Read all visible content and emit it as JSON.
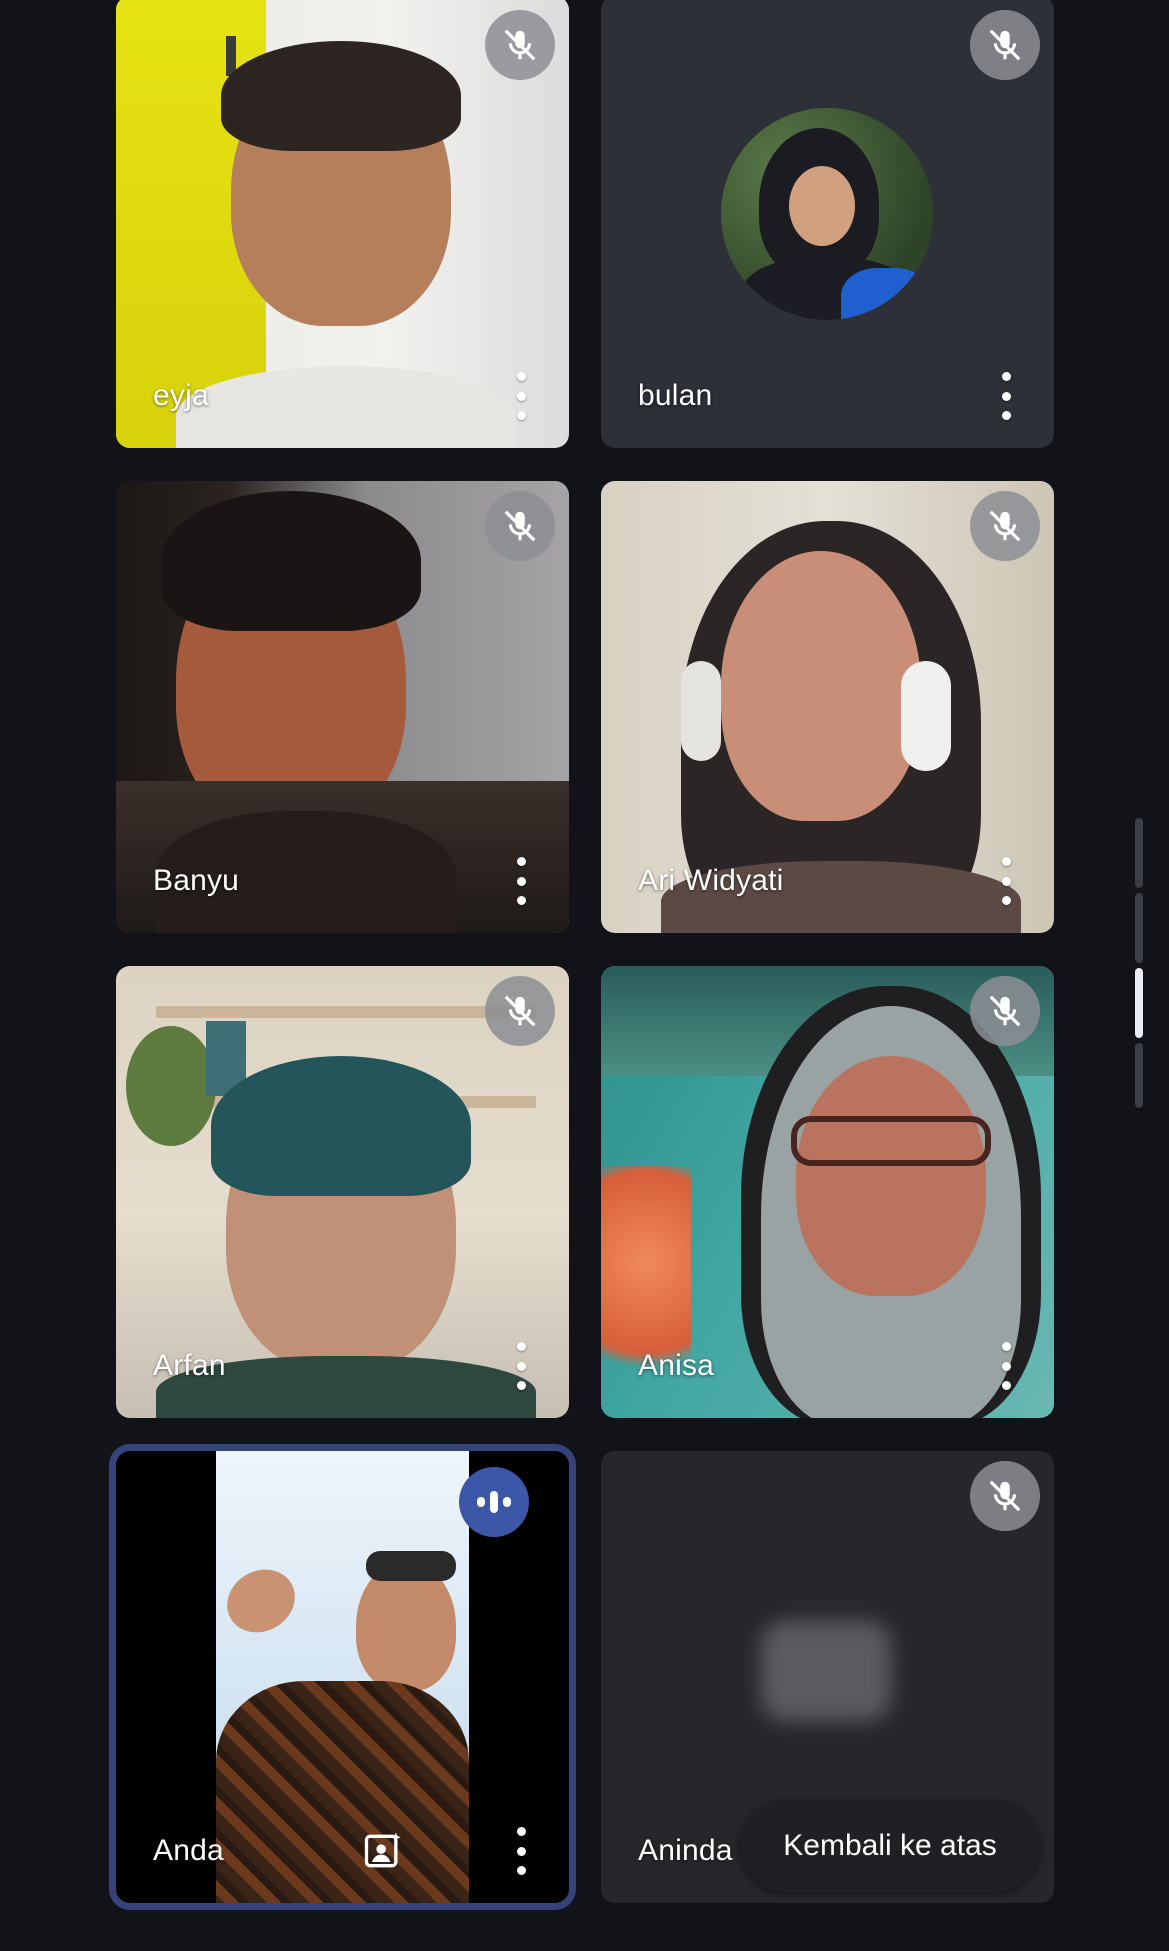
{
  "participants": [
    {
      "name": "eyja",
      "mic": "muted"
    },
    {
      "name": "bulan",
      "mic": "muted",
      "camera": "off-avatar"
    },
    {
      "name": "Banyu",
      "mic": "muted"
    },
    {
      "name": "Ari Widyati",
      "mic": "muted"
    },
    {
      "name": "Arfan",
      "mic": "muted"
    },
    {
      "name": "Anisa",
      "mic": "muted"
    },
    {
      "name": "Anda",
      "mic": "speaking",
      "self": true
    },
    {
      "name": "Aninda G",
      "mic": "muted",
      "camera": "off"
    }
  ],
  "back_to_top": "Kembali ke atas",
  "colors": {
    "background": "#111318",
    "tile": "#2d2f36",
    "active_border": "#34447a",
    "speaking_badge": "#3c57a8",
    "mute_badge": "#8c8e94"
  },
  "icons": [
    "mic-off-icon",
    "more-vert-icon",
    "speaking-indicator-icon",
    "visual-effects-icon"
  ]
}
